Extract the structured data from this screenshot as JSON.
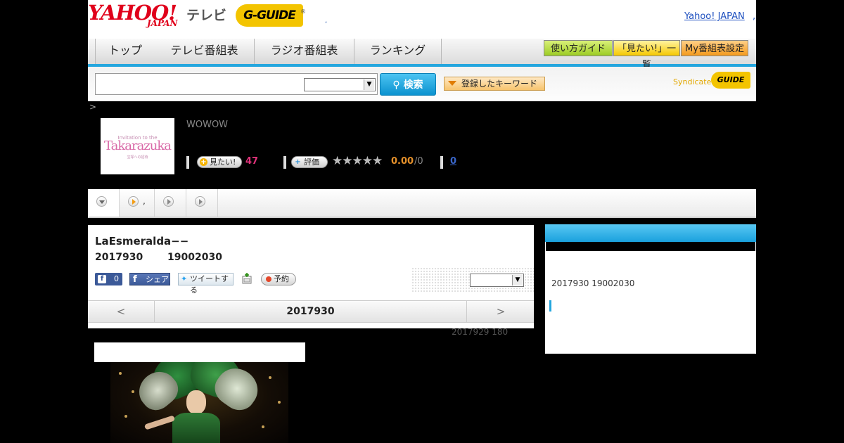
{
  "header": {
    "logo_text": "YAHOO!",
    "logo_sub": "JAPAN",
    "tv_label": "テレビ",
    "gguide_logo": "G-GUIDE",
    "gguide_reg": "®",
    "dot": ",",
    "top_link": "Yahoo! JAPAN",
    "top_link_dot": ","
  },
  "nav": {
    "tabs": [
      "トップ",
      "テレビ番組表",
      "ラジオ番組表",
      "ランキング"
    ],
    "guide_button": "使い方ガイド",
    "want_list_button": "「見たい!」一覧",
    "my_schedule_button": "My番組表設定"
  },
  "search": {
    "placeholder": "",
    "button_label": "検索",
    "keyword_button": "登録したキーワード",
    "syndicated_text": "Syndicated",
    "syndicated_logo": "GUIDE"
  },
  "breadcrumb": ">",
  "program": {
    "thumb_small": "Invitation to the",
    "thumb_title": "Takarazuka",
    "thumb_tiny": "宝塚への招待",
    "channel": "WOWOW",
    "want_label": "見たい!",
    "want_count": "47",
    "rate_label": "評価",
    "stars": "★★★★★",
    "rating": "0.00",
    "rating_total": "/0",
    "review_count": "0",
    "title": "LaEsmeralda−−",
    "date": "2017930",
    "time": "19002030",
    "fb_like_count": "0",
    "fb_share": "シェア",
    "tweet": "ツイートする",
    "reserve": "予約",
    "date_nav": {
      "prev": "<",
      "current": "2017930",
      "next": ">"
    },
    "note": "2017929  180"
  },
  "tab_strip": {
    "items": [
      "",
      ",",
      "",
      ""
    ]
  },
  "sidebar": {
    "text": "2017930  19002030"
  },
  "colors": {
    "accent": "#24a6de",
    "brand_red": "#e0001b",
    "gguide_yellow": "#f3c400",
    "want_pink": "#e0327a",
    "rating_orange": "#e5902a"
  }
}
